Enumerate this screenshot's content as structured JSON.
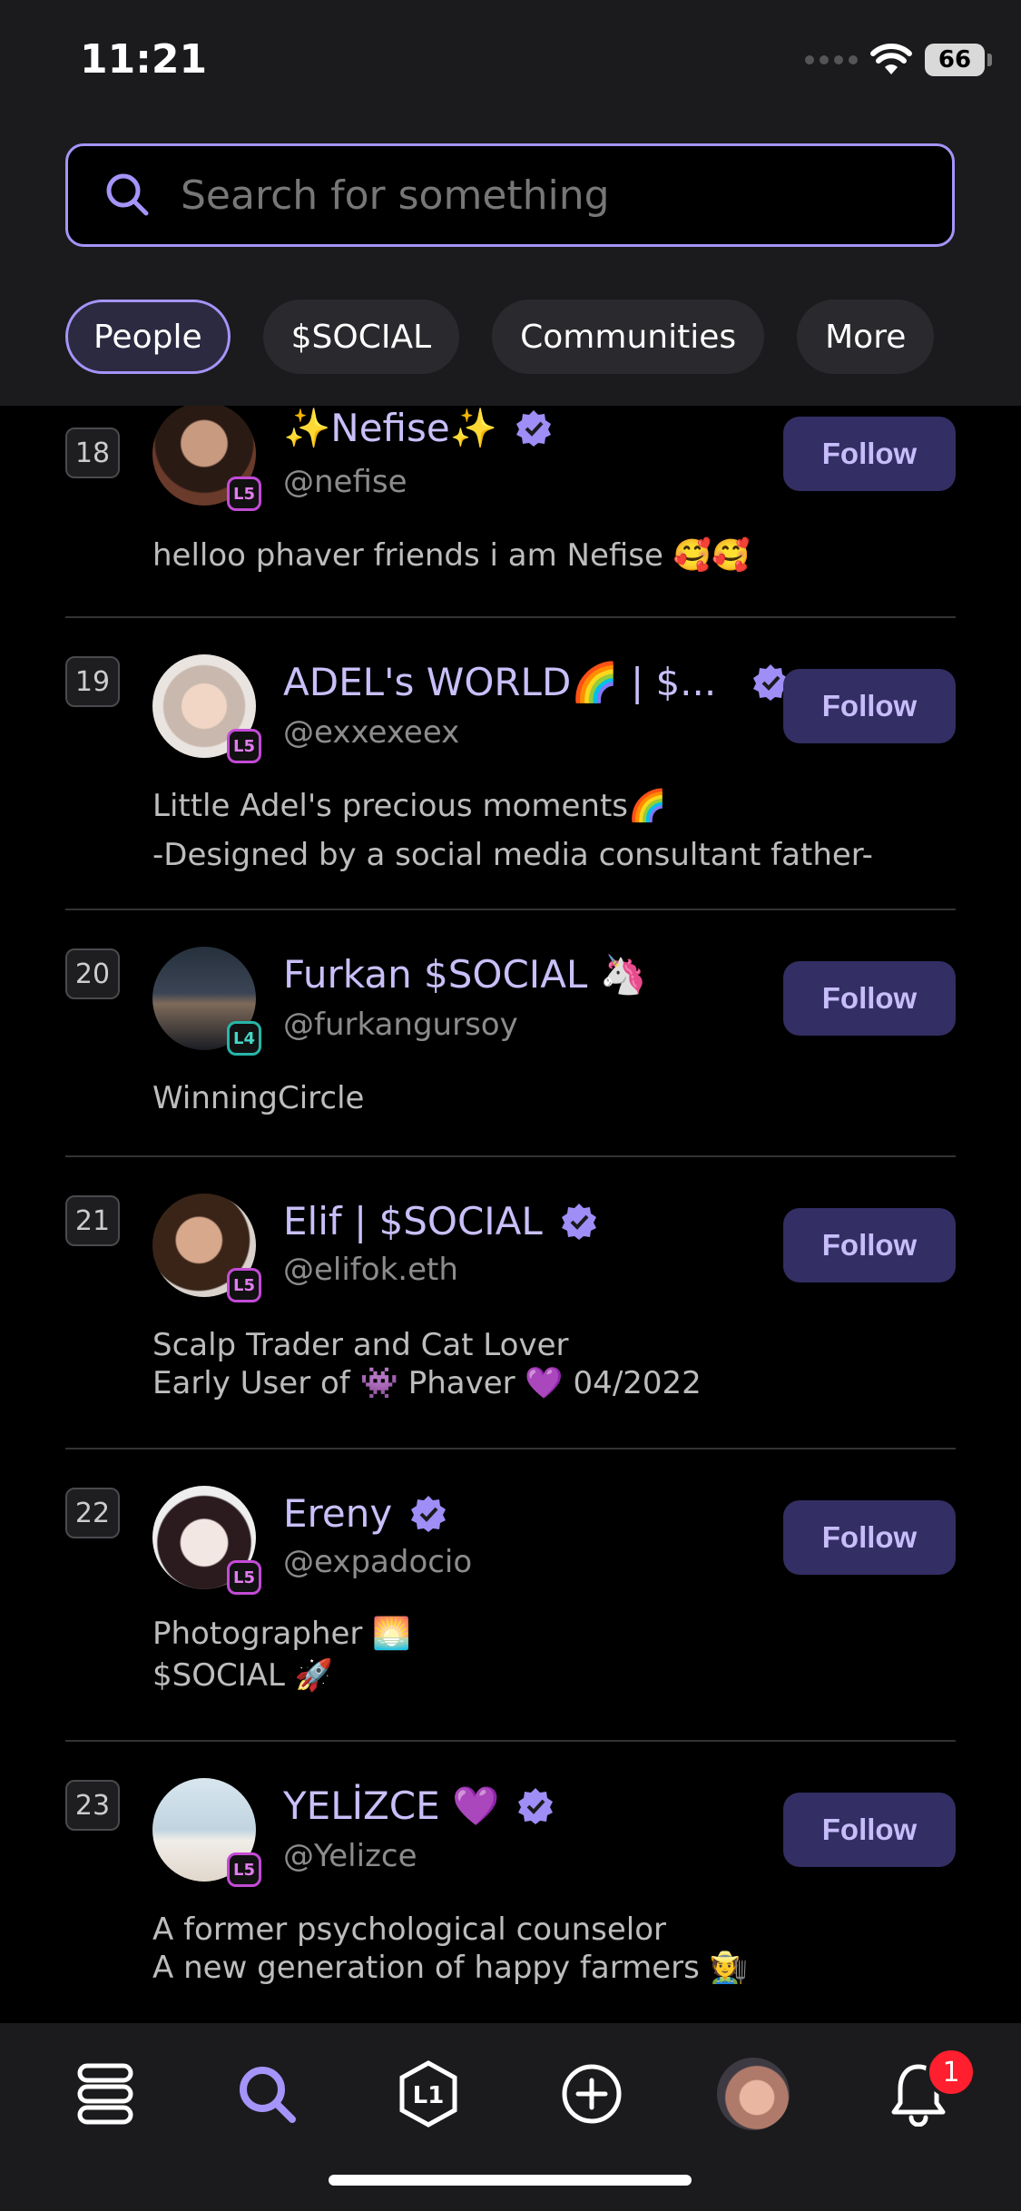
{
  "status_bar": {
    "time": "11:21",
    "battery": "66"
  },
  "search": {
    "placeholder": "Search for something"
  },
  "filters": [
    "People",
    "$SOCIAL",
    "Communities",
    "More"
  ],
  "follow_label": "Follow",
  "people": [
    {
      "rank": "18",
      "name": "✨Nefise✨",
      "handle": "@nefise",
      "level": "L5",
      "verified": true,
      "bio": "helloo phaver friends i am Nefise 🥰🥰"
    },
    {
      "rank": "19",
      "name": "ADEL's WORLD🌈 | $...",
      "handle": "@exxexeex",
      "level": "L5",
      "verified": true,
      "bio": "Little Adel's precious moments🌈\n-Designed by a social media consultant father-"
    },
    {
      "rank": "20",
      "name": "Furkan $SOCIAL 🦄",
      "handle": "@furkangursoy",
      "level": "L4",
      "verified": false,
      "bio": "WinningCircle"
    },
    {
      "rank": "21",
      "name": "Elif | $SOCIAL",
      "handle": "@elifok.eth",
      "level": "L5",
      "verified": true,
      "bio": "Scalp Trader and Cat Lover\nEarly User of 👾 Phaver 💜 04/2022"
    },
    {
      "rank": "22",
      "name": "Ereny",
      "handle": "@expadocio",
      "level": "L5",
      "verified": true,
      "bio": "Photographer 🌅\n$SOCIAL 🚀"
    },
    {
      "rank": "23",
      "name": "YELİZCE 💜",
      "handle": "@Yelizce",
      "level": "L5",
      "verified": true,
      "bio": "A former psychological counselor\nA new generation of happy farmers 🧑‍🌾"
    }
  ],
  "bottom_nav": {
    "items": [
      "feed-icon",
      "search-icon",
      "level-icon",
      "add-icon",
      "profile-avatar",
      "bell-icon"
    ],
    "level_label": "L1",
    "notification_count": "1"
  },
  "colors": {
    "accent": "#a594f9",
    "follow_bg": "#332e63",
    "badge": "#ff1f2e"
  }
}
